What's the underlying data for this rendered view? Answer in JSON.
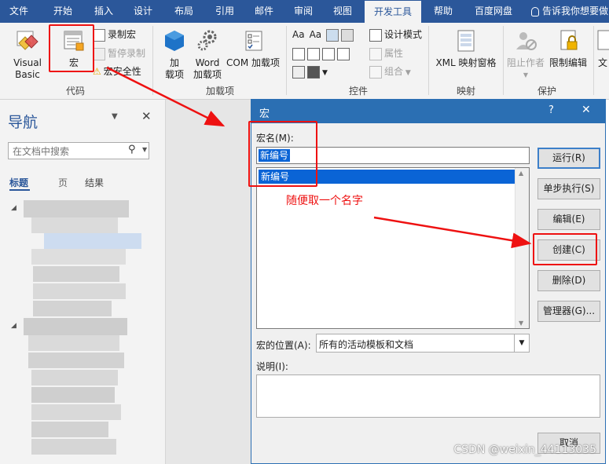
{
  "tabs": [
    "文件",
    "开始",
    "插入",
    "设计",
    "布局",
    "引用",
    "邮件",
    "审阅",
    "视图",
    "开发工具",
    "帮助",
    "百度网盘"
  ],
  "tell_me": "告诉我你想要做",
  "ribbon": {
    "code": {
      "label": "代码",
      "visual_basic": "Visual Basic",
      "macros": "宏",
      "record_macro": "录制宏",
      "pause_recording": "暂停录制",
      "macro_security": "宏安全性"
    },
    "addins": {
      "label": "加载项",
      "addins_line1": "加",
      "addins_line2": "载项",
      "word_line1": "Word",
      "word_line2": "加载项",
      "com": "COM 加载项"
    },
    "controls": {
      "label": "控件",
      "design_mode": "设计模式",
      "properties": "属性",
      "group": "组合"
    },
    "mapping": {
      "label": "映射",
      "xml": "XML 映射窗格"
    },
    "protect": {
      "label": "保护",
      "block_authors": "阻止作者",
      "restrict_editing": "限制编辑"
    },
    "template": {
      "label": "文"
    }
  },
  "nav": {
    "title": "导航",
    "search_placeholder": "在文档中搜索",
    "tab_headings": "标题",
    "tab_pages": "页",
    "tab_results": "结果"
  },
  "dialog": {
    "title": "宏",
    "help": "?",
    "close": "✕",
    "macro_name_label": "宏名(M):",
    "macro_name_value": "新编号",
    "list_items": [
      "新编号"
    ],
    "macros_in_label": "宏的位置(A):",
    "macros_in_value": "所有的活动模板和文档",
    "description_label": "说明(I):",
    "buttons": {
      "run": "运行(R)",
      "step_into": "单步执行(S)",
      "edit": "编辑(E)",
      "create": "创建(C)",
      "delete": "删除(D)",
      "organizer": "管理器(G)...",
      "cancel": "取消"
    }
  },
  "annotation": "随便取一个名字",
  "watermark": "CSDN @weixin_44113035",
  "colors": {
    "accent": "#2b579a",
    "dialog_title": "#2b6fb3",
    "annotation_red": "#ee1111",
    "selection": "#0a64d6"
  }
}
